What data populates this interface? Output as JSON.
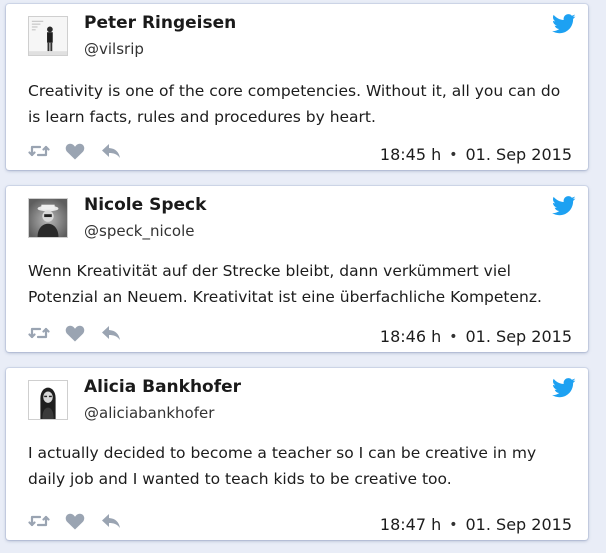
{
  "colors": {
    "twitter_blue": "#1da1f2",
    "action_gray": "#9aa4b2",
    "background": "#e9edf7"
  },
  "tweets": [
    {
      "name": "Peter Ringeisen",
      "handle": "@vilsrip",
      "text": "Creativity is one of the core competencies. Without it, all you can do is learn facts, rules and procedures by heart.",
      "time": "18:45 h",
      "separator": "•",
      "date": "01. Sep 2015",
      "icons": [
        "retweet-icon",
        "heart-icon",
        "reply-icon",
        "twitter-bird-icon"
      ]
    },
    {
      "name": "Nicole Speck",
      "handle": "@speck_nicole",
      "text": "Wenn Kreativität auf der Strecke bleibt, dann verkümmert viel Potenzial an Neuem. Kreativitat ist eine überfachliche Kompetenz.",
      "time": "18:46 h",
      "separator": "•",
      "date": "01. Sep 2015",
      "icons": [
        "retweet-icon",
        "heart-icon",
        "reply-icon",
        "twitter-bird-icon"
      ]
    },
    {
      "name": "Alicia Bankhofer",
      "handle": "@aliciabankhofer",
      "text": "I actually decided to become a teacher so I can be creative in my daily job and I wanted to teach kids to be creative too.",
      "time": "18:47 h",
      "separator": "•",
      "date": "01. Sep 2015",
      "icons": [
        "retweet-icon",
        "heart-icon",
        "reply-icon",
        "twitter-bird-icon"
      ]
    }
  ]
}
